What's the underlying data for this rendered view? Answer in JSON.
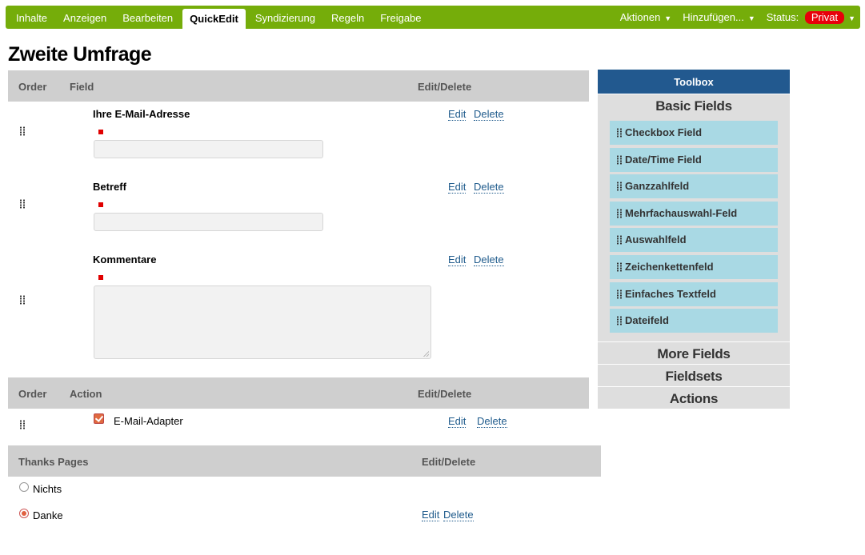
{
  "tabs": [
    {
      "label": "Inhalte"
    },
    {
      "label": "Anzeigen"
    },
    {
      "label": "Bearbeiten"
    },
    {
      "label": "QuickEdit"
    },
    {
      "label": "Syndizierung"
    },
    {
      "label": "Regeln"
    },
    {
      "label": "Freigabe"
    }
  ],
  "active_tab": "QuickEdit",
  "menu": {
    "actions": "Aktionen",
    "add": "Hinzufügen...",
    "status_label": "Status:",
    "status_value": "Privat"
  },
  "page_title": "Zweite Umfrage",
  "fields_table": {
    "headers": {
      "order": "Order",
      "field": "Field",
      "edit_delete": "Edit/Delete"
    },
    "rows": [
      {
        "label": "Ihre E-Mail-Adresse",
        "edit": "Edit",
        "delete": "Delete"
      },
      {
        "label": "Betreff",
        "edit": "Edit",
        "delete": "Delete"
      },
      {
        "label": "Kommentare",
        "edit": "Edit",
        "delete": "Delete"
      }
    ]
  },
  "actions_table": {
    "headers": {
      "order": "Order",
      "action": "Action",
      "edit_delete": "Edit/Delete"
    },
    "rows": [
      {
        "label": "E-Mail-Adapter",
        "edit": "Edit",
        "delete": "Delete"
      }
    ]
  },
  "thanks_table": {
    "headers": {
      "thanks": "Thanks Pages",
      "edit_delete": "Edit/Delete"
    },
    "rows": [
      {
        "label": "Nichts"
      },
      {
        "label": "Danke",
        "edit": "Edit",
        "delete": "Delete"
      }
    ]
  },
  "toolbox": {
    "title": "Toolbox",
    "basic": "Basic Fields",
    "items": [
      "Checkbox Field",
      "Date/Time Field",
      "Ganzzahlfeld",
      "Mehrfachauswahl-Feld",
      "Auswahlfeld",
      "Zeichenkettenfeld",
      "Einfaches Textfeld",
      "Dateifeld"
    ],
    "more": "More Fields",
    "fieldsets": "Fieldsets",
    "actions": "Actions"
  },
  "colors": {
    "topbar": "#75ad0a",
    "status_badge": "#e8000b",
    "toolbox_header": "#22598f",
    "toolbox_item": "#a9d9e4",
    "link": "#1f5b8c"
  }
}
